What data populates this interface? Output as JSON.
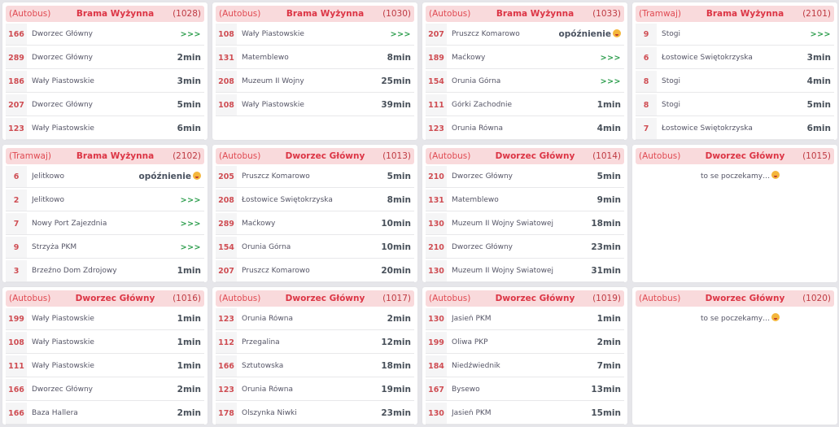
{
  "separator": "",
  "empty_text": "to se poczekamy…",
  "cards": [
    {
      "type": "(Autobus)",
      "stop": "Brama Wyżynna",
      "code": "(1028)",
      "rows": [
        {
          "line": "166",
          "dest": "Dworzec Główny",
          "time": ">>>"
        },
        {
          "line": "289",
          "dest": "Dworzec Główny",
          "time": "2min"
        },
        {
          "line": "186",
          "dest": "Wały Piastowskie",
          "time": "3min"
        },
        {
          "line": "207",
          "dest": "Dworzec Główny",
          "time": "5min"
        },
        {
          "line": "123",
          "dest": "Wały Piastowskie",
          "time": "6min"
        }
      ]
    },
    {
      "type": "(Autobus)",
      "stop": "Brama Wyżynna",
      "code": "(1030)",
      "rows": [
        {
          "line": "108",
          "dest": "Wały Piastowskie",
          "time": ">>>"
        },
        {
          "line": "131",
          "dest": "Matemblewo",
          "time": "8min"
        },
        {
          "line": "208",
          "dest": "Muzeum II Wojny",
          "time": "25min"
        },
        {
          "line": "108",
          "dest": "Wały Piastowskie",
          "time": "39min"
        }
      ]
    },
    {
      "type": "(Autobus)",
      "stop": "Brama Wyżynna",
      "code": "(1033)",
      "rows": [
        {
          "line": "207",
          "dest": "Pruszcz Komarowo",
          "time": "opóźnienie"
        },
        {
          "line": "189",
          "dest": "Maćkowy",
          "time": ">>>"
        },
        {
          "line": "154",
          "dest": "Orunia Górna",
          "time": ">>>"
        },
        {
          "line": "111",
          "dest": "Górki Zachodnie",
          "time": "1min"
        },
        {
          "line": "123",
          "dest": "Orunia Równa",
          "time": "4min"
        }
      ]
    },
    {
      "type": "(Tramwaj)",
      "stop": "Brama Wyżynna",
      "code": "(2101)",
      "rows": [
        {
          "line": "9",
          "dest": "Stogi",
          "time": ">>>"
        },
        {
          "line": "6",
          "dest": "Łostowice Świętokrzyska",
          "time": "3min"
        },
        {
          "line": "8",
          "dest": "Stogi",
          "time": "4min"
        },
        {
          "line": "8",
          "dest": "Stogi",
          "time": "5min"
        },
        {
          "line": "7",
          "dest": "Łostowice Świętokrzyska",
          "time": "6min"
        }
      ]
    },
    {
      "type": "(Tramwaj)",
      "stop": "Brama Wyżynna",
      "code": "(2102)",
      "rows": [
        {
          "line": "6",
          "dest": "Jelitkowo",
          "time": "opóźnienie"
        },
        {
          "line": "2",
          "dest": "Jelitkowo",
          "time": ">>>"
        },
        {
          "line": "7",
          "dest": "Nowy Port Zajezdnia",
          "time": ">>>"
        },
        {
          "line": "9",
          "dest": "Strzyża PKM",
          "time": ">>>"
        },
        {
          "line": "3",
          "dest": "Brzeźno Dom Zdrojowy",
          "time": "1min"
        }
      ]
    },
    {
      "type": "(Autobus)",
      "stop": "Dworzec Główny",
      "code": "(1013)",
      "rows": [
        {
          "line": "205",
          "dest": "Pruszcz Komarowo",
          "time": "5min"
        },
        {
          "line": "208",
          "dest": "Łostowice Świętokrzyska",
          "time": "8min"
        },
        {
          "line": "289",
          "dest": "Maćkowy",
          "time": "10min"
        },
        {
          "line": "154",
          "dest": "Orunia Górna",
          "time": "10min"
        },
        {
          "line": "207",
          "dest": "Pruszcz Komarowo",
          "time": "20min"
        }
      ]
    },
    {
      "type": "(Autobus)",
      "stop": "Dworzec Główny",
      "code": "(1014)",
      "rows": [
        {
          "line": "210",
          "dest": "Dworzec Główny",
          "time": "5min"
        },
        {
          "line": "131",
          "dest": "Matemblewo",
          "time": "9min"
        },
        {
          "line": "130",
          "dest": "Muzeum II Wojny Światowej",
          "time": "18min"
        },
        {
          "line": "210",
          "dest": "Dworzec Główny",
          "time": "23min"
        },
        {
          "line": "130",
          "dest": "Muzeum II Wojny Światowej",
          "time": "31min"
        }
      ]
    },
    {
      "type": "(Autobus)",
      "stop": "Dworzec Główny",
      "code": "(1015)",
      "rows": []
    },
    {
      "type": "(Autobus)",
      "stop": "Dworzec Główny",
      "code": "(1016)",
      "rows": [
        {
          "line": "199",
          "dest": "Wały Piastowskie",
          "time": "1min"
        },
        {
          "line": "108",
          "dest": "Wały Piastowskie",
          "time": "1min"
        },
        {
          "line": "111",
          "dest": "Wały Piastowskie",
          "time": "1min"
        },
        {
          "line": "166",
          "dest": "Dworzec Główny",
          "time": "2min"
        },
        {
          "line": "166",
          "dest": "Baza Hallera",
          "time": "2min"
        }
      ]
    },
    {
      "type": "(Autobus)",
      "stop": "Dworzec Główny",
      "code": "(1017)",
      "rows": [
        {
          "line": "123",
          "dest": "Orunia Równa",
          "time": "2min"
        },
        {
          "line": "112",
          "dest": "Przegalina",
          "time": "12min"
        },
        {
          "line": "166",
          "dest": "Sztutowska",
          "time": "18min"
        },
        {
          "line": "123",
          "dest": "Orunia Równa",
          "time": "19min"
        },
        {
          "line": "178",
          "dest": "Olszynka Niwki",
          "time": "23min"
        }
      ]
    },
    {
      "type": "(Autobus)",
      "stop": "Dworzec Główny",
      "code": "(1019)",
      "rows": [
        {
          "line": "130",
          "dest": "Jasień PKM",
          "time": "1min"
        },
        {
          "line": "199",
          "dest": "Oliwa PKP",
          "time": "2min"
        },
        {
          "line": "184",
          "dest": "Niedźwiednik",
          "time": "7min"
        },
        {
          "line": "167",
          "dest": "Bysewo",
          "time": "13min"
        },
        {
          "line": "130",
          "dest": "Jasień PKM",
          "time": "15min"
        }
      ]
    },
    {
      "type": "(Autobus)",
      "stop": "Dworzec Główny",
      "code": "(1020)",
      "rows": []
    }
  ]
}
